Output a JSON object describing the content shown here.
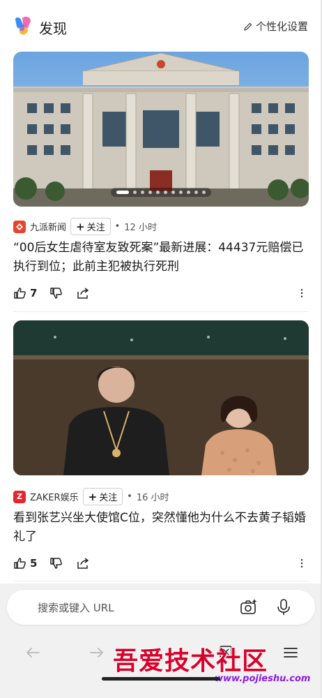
{
  "header": {
    "title": "发现",
    "settings_label": "个性化设置"
  },
  "feed": [
    {
      "source": "九派新闻",
      "source_color": "#e8442d",
      "follow_label": "关注",
      "separator": "•",
      "time": "12 小时",
      "headline": "“00后女生虐待室友致死案”最新进展：44437元赔偿已执行到位；此前主犯被执行死刑",
      "likes": "7",
      "carousel_total": 11,
      "carousel_active": 1
    },
    {
      "source": "ZAKER娱乐",
      "source_color": "#e8242d",
      "source_icon_letter": "Z",
      "follow_label": "关注",
      "separator": "•",
      "time": "16 小时",
      "headline": "看到张艺兴坐大使馆C位，突然懂他为什么不去黄子韬婚礼了",
      "likes": "5"
    }
  ],
  "search": {
    "placeholder": "搜索或键入 URL"
  },
  "watermark": {
    "main": "吾爱技术社区",
    "sub": "www.pojieshu.com"
  }
}
